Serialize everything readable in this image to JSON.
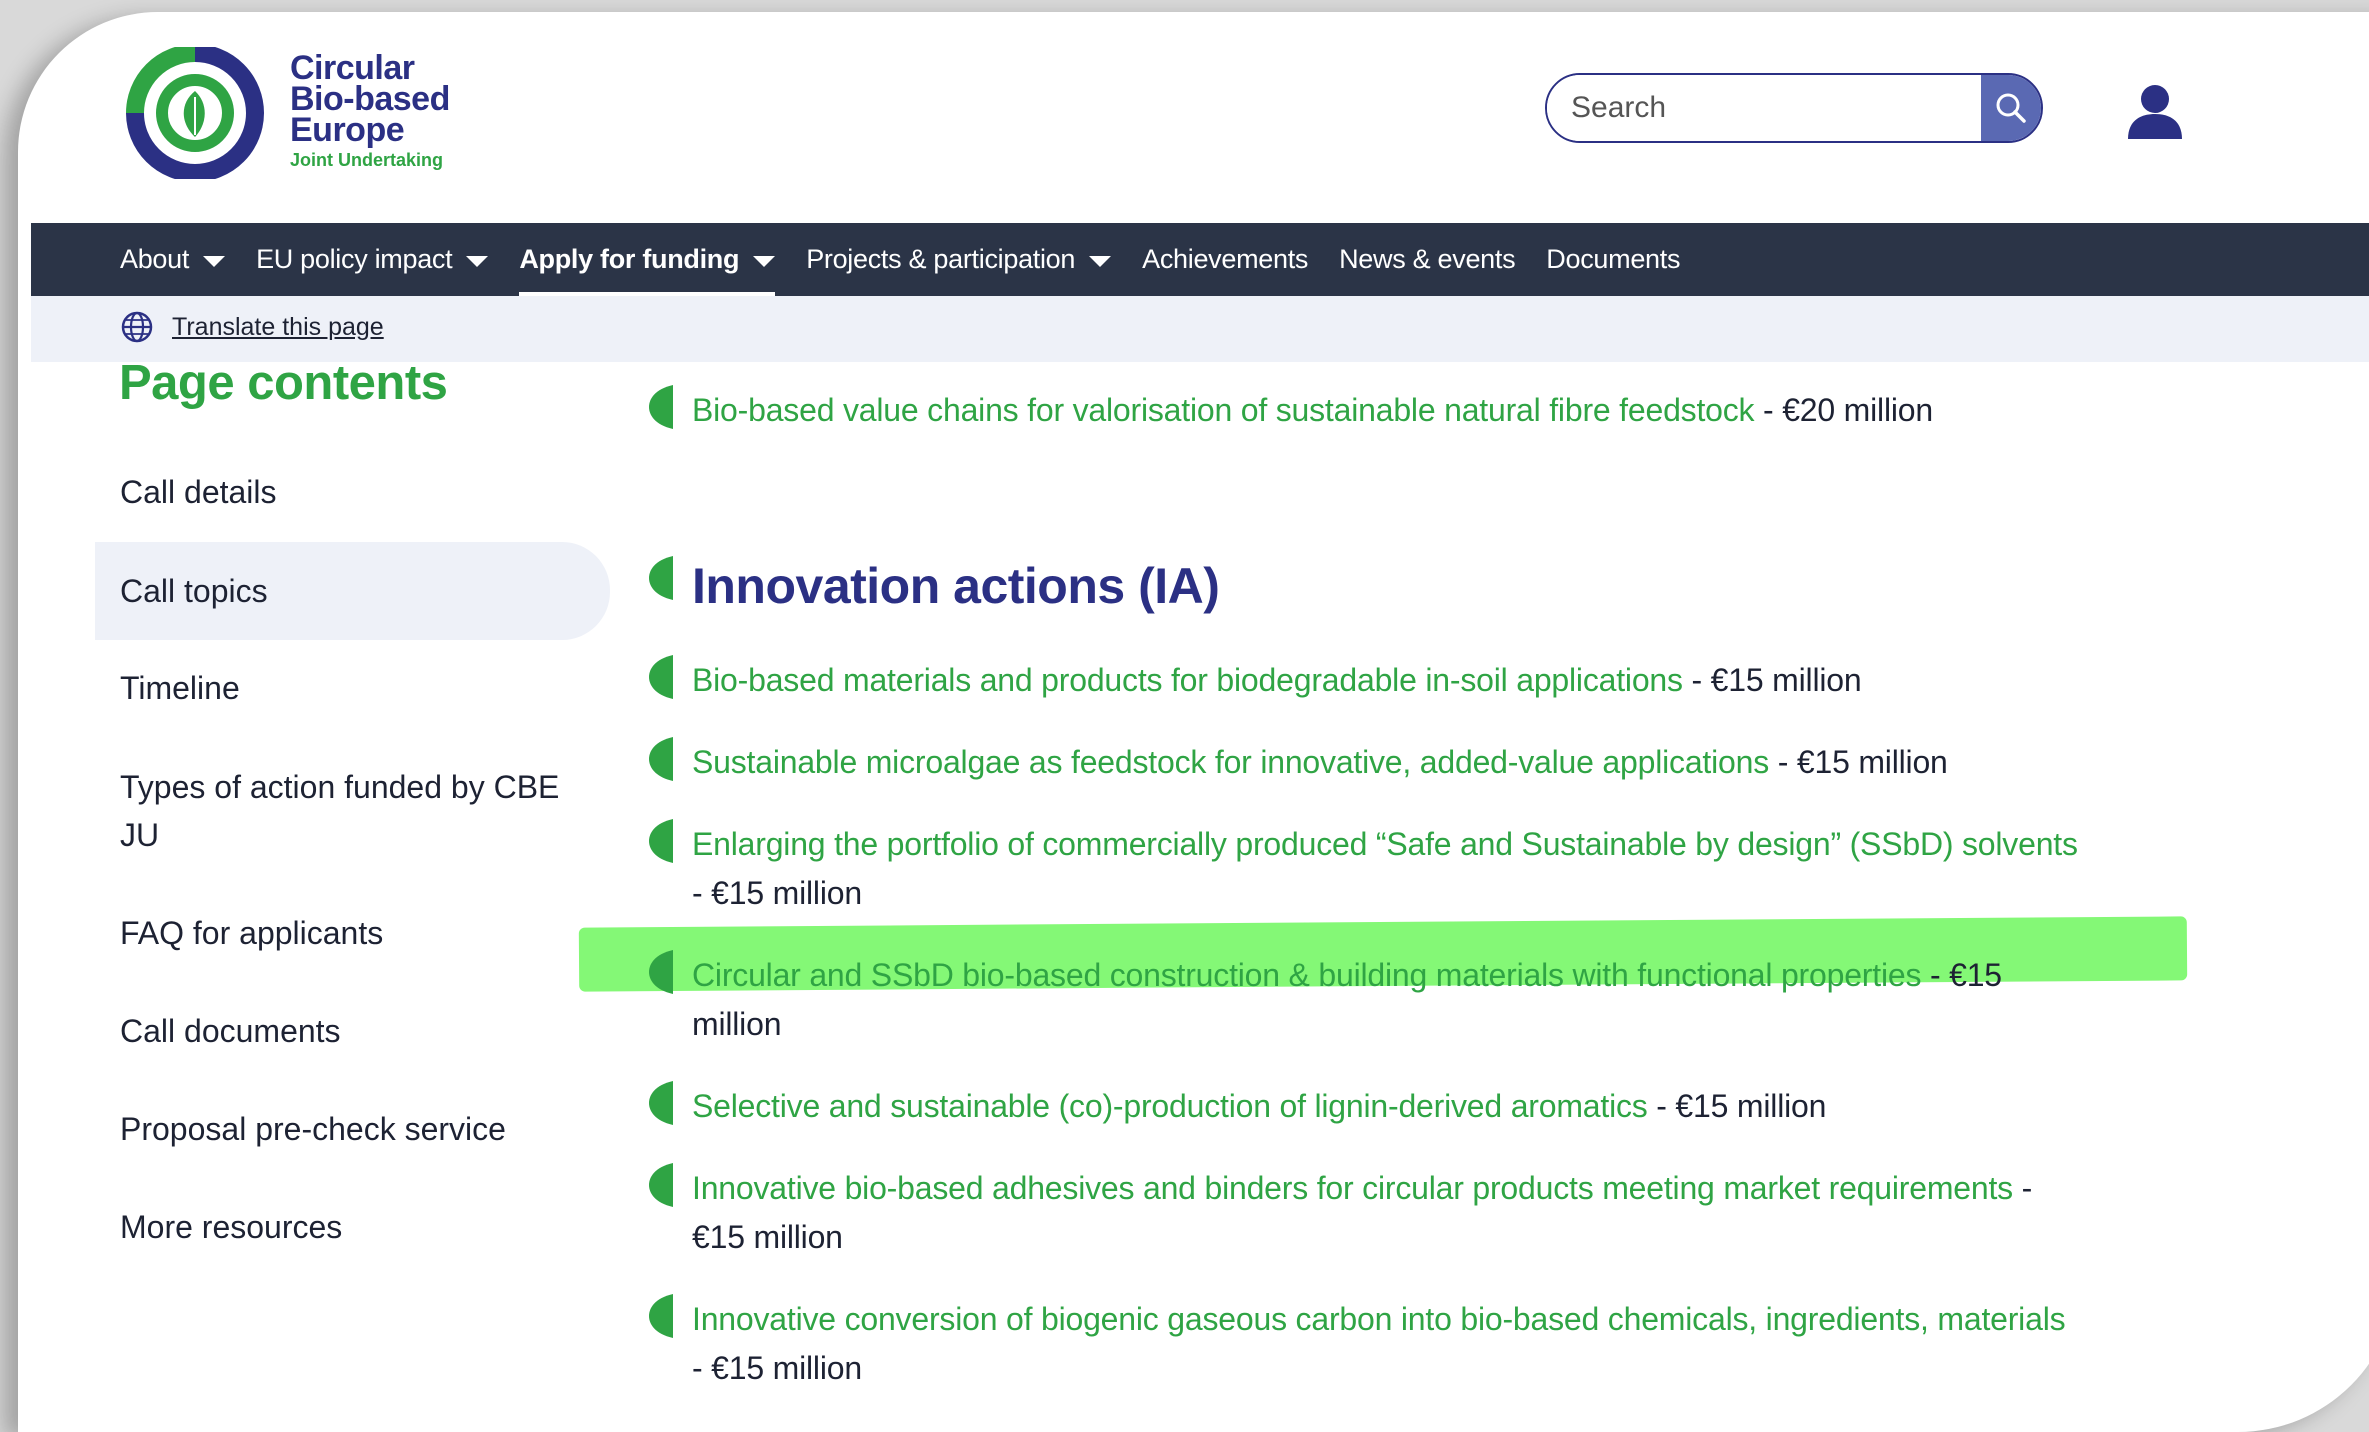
{
  "logo": {
    "line1": "Circular",
    "line2": "Bio-based",
    "line3": "Europe",
    "sub": "Joint Undertaking"
  },
  "search": {
    "placeholder": "Search"
  },
  "icons": {
    "search": "search-icon",
    "user": "user-icon",
    "globe": "globe-icon",
    "leaf": "leaf-bullet-icon"
  },
  "colors": {
    "green": "#2fa444",
    "navy": "#2b3084",
    "nav_bg": "#2b3447",
    "highlight": "#55f541"
  },
  "nav": [
    {
      "label": "About",
      "has_dropdown": true
    },
    {
      "label": "EU policy impact",
      "has_dropdown": true
    },
    {
      "label": "Apply for funding",
      "has_dropdown": true,
      "active": true
    },
    {
      "label": "Projects & participation",
      "has_dropdown": true
    },
    {
      "label": "Achievements"
    },
    {
      "label": "News & events"
    },
    {
      "label": "Documents"
    }
  ],
  "translate": {
    "label": "Translate this page"
  },
  "sidebar": {
    "title": "Page contents",
    "items": [
      {
        "label": "Call details"
      },
      {
        "label": "Call topics",
        "active": true
      },
      {
        "label": "Timeline"
      },
      {
        "label": "Types of action funded by CBE",
        "label2": "JU"
      },
      {
        "label": "FAQ for applicants"
      },
      {
        "label": "Call documents"
      },
      {
        "label": "Proposal pre-check service"
      },
      {
        "label": "More resources"
      }
    ]
  },
  "content": {
    "top_topic": {
      "title": "Bio-based value chains for valorisation of sustainable natural fibre feedstock",
      "amount": " - €20 million"
    },
    "ia_heading": "Innovation actions (IA)",
    "topics": [
      {
        "title": "Bio-based materials and products for biodegradable in-soil applications",
        "amount": " - €15 million"
      },
      {
        "title": "Sustainable microalgae as feedstock for innovative, added-value applications",
        "amount": " - €15 million"
      },
      {
        "title": "Enlarging the portfolio of commercially produced “Safe and Sustainable by design” (SSbD) solvents",
        "amount": "- €15 million"
      },
      {
        "title": "Circular and SSbD bio-based construction & building materials with functional properties",
        "amount_a": " - €15",
        "amount_b": "million",
        "highlighted": true
      },
      {
        "title": "Selective and sustainable (co)-production of lignin-derived aromatics",
        "amount": " - €15 million"
      },
      {
        "title": "Innovative bio-based adhesives and binders for circular products meeting market requirements",
        "amount_a": " -",
        "amount_b": "€15 million"
      },
      {
        "title": "Innovative conversion of biogenic gaseous carbon into bio-based chemicals, ingredients, materials",
        "amount": "- €15 million"
      }
    ]
  }
}
